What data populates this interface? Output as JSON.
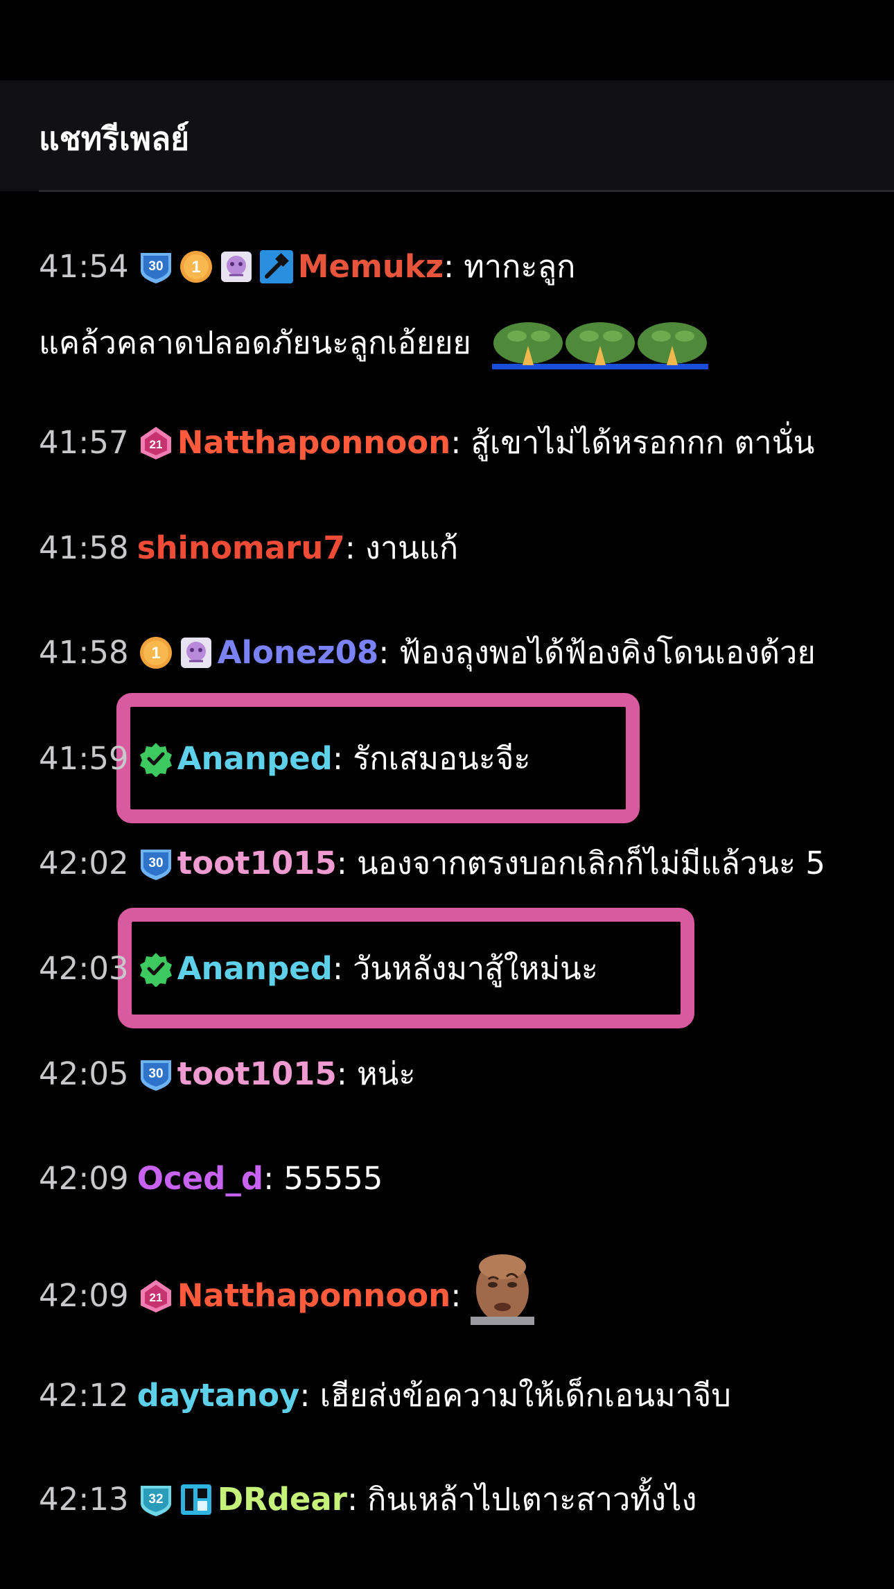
{
  "header": {
    "title": "แชทรีเพลย์"
  },
  "colors": {
    "background": "#000000",
    "header_bg": "#111114",
    "highlight": "#d85a9f"
  },
  "messages": [
    {
      "time": "41:54",
      "user": "Memukz",
      "color": "#e8553d",
      "text": "ทากะลูก",
      "badges": [
        "sub-30-badge",
        "bits-1-badge",
        "emote-badge",
        "moderator-hammer-badge"
      ],
      "continuation": "แคล้วคลาดปลอดภัยนะลูกเอ้ยยย"
    },
    {
      "time": "41:57",
      "user": "Natthaponnoon",
      "color": "#ff5a3c",
      "text": "สู้เขาไม่ได้หรอกกก ตานั่น",
      "badges": [
        "sub-21-badge"
      ]
    },
    {
      "time": "41:58",
      "user": "shinomaru7",
      "color": "#ef4c37",
      "text": "งานแก้",
      "badges": []
    },
    {
      "time": "41:58",
      "user": "Alonez08",
      "color": "#7b82f5",
      "text": "ฟ้องลุงพอได้ฟ้องคิงโดนเองด้วย",
      "badges": [
        "bits-1-badge",
        "emote-badge"
      ]
    },
    {
      "time": "41:59",
      "user": "Ananped",
      "color": "#5ed0e9",
      "text": "รักเสมอนะจีะ",
      "badges": [
        "verified-badge"
      ]
    },
    {
      "time": "42:02",
      "user": "toot1015",
      "color": "#ef9ad0",
      "text": "นองจากตรงบอกเลิกก็ไม่มีแล้วนะ 5",
      "badges": [
        "sub-30-badge"
      ]
    },
    {
      "time": "42:03",
      "user": "Ananped",
      "color": "#5ed0e9",
      "text": "วันหลังมาสู้ใหม่นะ",
      "badges": [
        "verified-badge"
      ]
    },
    {
      "time": "42:05",
      "user": "toot1015",
      "color": "#ef9ad0",
      "text": "หน่ะ",
      "badges": [
        "sub-30-badge"
      ]
    },
    {
      "time": "42:09",
      "user": "Oced_d",
      "color": "#c763f0",
      "text": "55555",
      "badges": []
    },
    {
      "time": "42:09",
      "user": "Natthaponnoon",
      "color": "#ff5a3c",
      "text": "",
      "badges": [
        "sub-21-badge"
      ],
      "emote": "rock-face-emote"
    },
    {
      "time": "42:12",
      "user": "daytanoy",
      "color": "#5ed0e9",
      "text": "เฮียส่งข้อความให้เด็กเอนมาจีบ",
      "badges": []
    },
    {
      "time": "42:13",
      "user": "DRdear",
      "color": "#c6f27a",
      "text": "กินเหล้าไปเตาะสาวทั้งไง",
      "badges": [
        "sub-32-badge",
        "glitch-badge"
      ]
    }
  ],
  "badge_labels": {
    "sub30": "30",
    "sub21": "21",
    "sub32": "32",
    "bits1": "1"
  }
}
